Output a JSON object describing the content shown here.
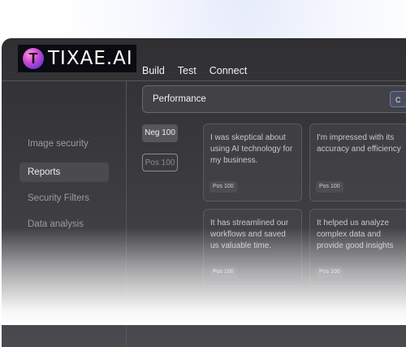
{
  "brand": {
    "logo_letter": "T",
    "logo_text": "TIXAE.AI",
    "accent": "#6a79c9"
  },
  "sidebar": {
    "items": [
      {
        "label": "Image security",
        "active": false
      },
      {
        "label": "Reports",
        "active": true
      },
      {
        "label": "Security Filters",
        "active": false
      },
      {
        "label": "Data analysis",
        "active": false
      }
    ]
  },
  "tabs": [
    {
      "label": "Build"
    },
    {
      "label": "Test"
    },
    {
      "label": "Connect"
    }
  ],
  "search": {
    "value": "Performance",
    "button_label": "C"
  },
  "filters": [
    {
      "label": "Neg 100",
      "active": true
    },
    {
      "label": "Pos 100",
      "active": false
    }
  ],
  "cards": [
    {
      "text": "I was skeptical about using AI technology for my business.",
      "badge": "Pos 100"
    },
    {
      "text": "I'm impressed with its accuracy and efficiency",
      "badge": "Pos 100"
    },
    {
      "text": "It has streamlined our workflows and saved us valuable time.",
      "badge": "Pos 100"
    },
    {
      "text": "It helped us analyze complex data and provide good insights",
      "badge": "Pos 100"
    }
  ]
}
